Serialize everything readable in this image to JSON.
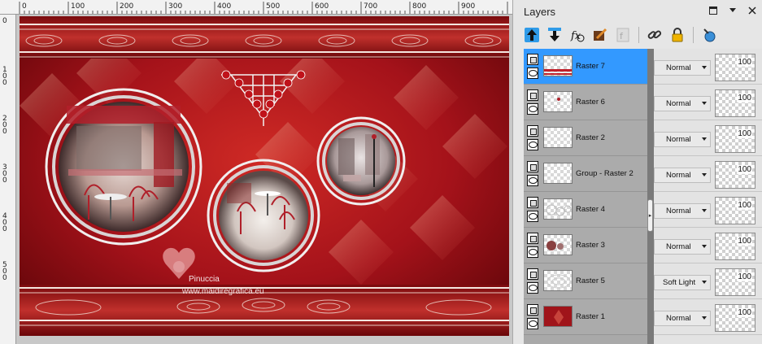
{
  "panel": {
    "title": "Layers"
  },
  "canvas": {
    "ruler_top_labels": [
      "0",
      "100",
      "200",
      "300",
      "400",
      "500",
      "600",
      "700",
      "800",
      "900"
    ],
    "ruler_left_labels": [
      "0",
      "100",
      "200",
      "300",
      "400",
      "500"
    ],
    "watermark_name": "Pinuccia",
    "watermark_url": "www.maidiregrafica.eu"
  },
  "toolbar": {
    "tools": [
      "move-layer-up-icon",
      "move-layer-down-icon",
      "fx-icon",
      "edit-icon",
      "mask-icon",
      "link-icon",
      "lock-icon",
      "properties-icon"
    ]
  },
  "layers": [
    {
      "name": "Raster 7",
      "blend_mode": "Normal",
      "opacity": "100",
      "selected": true
    },
    {
      "name": "Raster 6",
      "blend_mode": "Normal",
      "opacity": "100",
      "selected": false
    },
    {
      "name": "Raster 2",
      "blend_mode": "Normal",
      "opacity": "100",
      "selected": false
    },
    {
      "name": "Group - Raster 2",
      "blend_mode": "Normal",
      "opacity": "100",
      "selected": false
    },
    {
      "name": "Raster 4",
      "blend_mode": "Normal",
      "opacity": "100",
      "selected": false
    },
    {
      "name": "Raster 3",
      "blend_mode": "Normal",
      "opacity": "100",
      "selected": false
    },
    {
      "name": "Raster 5",
      "blend_mode": "Soft Light",
      "opacity": "100",
      "selected": false
    },
    {
      "name": "Raster 1",
      "blend_mode": "Normal",
      "opacity": "100",
      "selected": false
    }
  ],
  "colors": {
    "selection": "#3399ff",
    "canvas_red": "#b0161a",
    "canvas_dark_red": "#6e0606",
    "silver": "#e8e8e8"
  }
}
